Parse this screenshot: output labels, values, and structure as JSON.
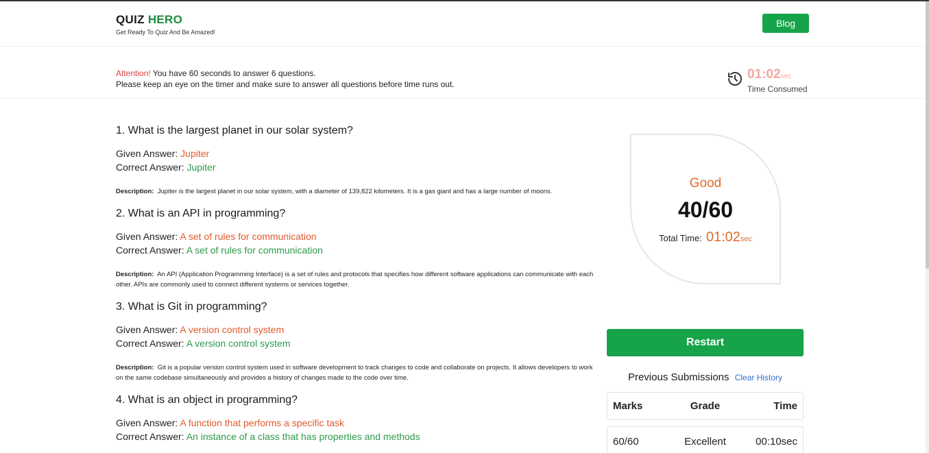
{
  "header": {
    "brand_part1": "QUIZ",
    "brand_part2": "HERO",
    "tagline": "Get Ready To Quiz And Be Amazed!",
    "blog_label": "Blog"
  },
  "notice": {
    "attention": "Attention!",
    "line1": " You have 60 seconds to answer 6 questions.",
    "line2": "Please keep an eye on the timer and make sure to answer all questions before time runs out.",
    "timer_value": "01:02",
    "timer_unit": "sec",
    "timer_label": "Time Consumed"
  },
  "labels": {
    "given": "Given Answer: ",
    "correct": "Correct Answer: ",
    "description": "Description:"
  },
  "questions": [
    {
      "title": "1. What is the largest planet in our solar system?",
      "given": "Jupiter",
      "correct": "Jupiter",
      "description": "Jupiter is the largest planet in our solar system, with a diameter of 139,822 kilometers. It is a gas giant and has a large number of moons."
    },
    {
      "title": "2. What is an API in programming?",
      "given": "A set of rules for communication",
      "correct": "A set of rules for communication",
      "description": "An API (Application Programming Interface) is a set of rules and protocols that specifies how different software applications can communicate with each other. APIs are commonly used to connect different systems or services together."
    },
    {
      "title": "3. What is Git in programming?",
      "given": "A version control system",
      "correct": "A version control system",
      "description": "Git is a popular version control system used in software development to track changes to code and collaborate on projects. It allows developers to work on the same codebase simultaneously and provides a history of changes made to the code over time."
    },
    {
      "title": "4. What is an object in programming?",
      "given": "A function that performs a specific task",
      "correct": "An instance of a class that has properties and methods",
      "description": ""
    }
  ],
  "result": {
    "grade": "Good",
    "score": "40/60",
    "total_time_label": "Total Time:",
    "total_time_value": "01:02",
    "total_time_unit": "sec",
    "restart_label": "Restart"
  },
  "submissions": {
    "title": "Previous Submissions",
    "clear_label": "Clear History",
    "headers": [
      "Marks",
      "Grade",
      "Time"
    ],
    "rows": [
      [
        "60/60",
        "Excellent",
        "00:10sec"
      ]
    ]
  },
  "colors": {
    "accent_green": "#16a34a",
    "given_orange": "#e05a2b",
    "correct_green": "#2e9a4a",
    "attention_red": "#d64545",
    "timer_pink": "#f4a6a0"
  }
}
